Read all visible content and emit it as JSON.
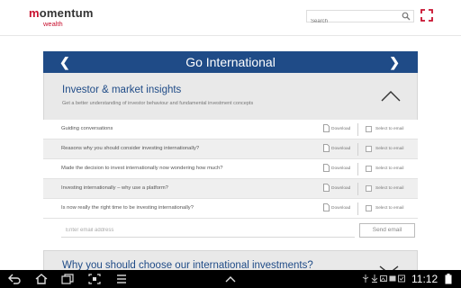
{
  "header": {
    "logo_name": "omentum",
    "logo_initial": "m",
    "logo_sub": "wealth",
    "search_placeholder": "Search"
  },
  "banner": {
    "title": "Go International",
    "prev_glyph": "❮",
    "next_glyph": "❯",
    "color": "#1f4b87"
  },
  "section": {
    "title": "Investor & market insights",
    "description": "Get a better understanding of investor behaviour and fundamental investment concepts",
    "expanded": true
  },
  "rows": [
    {
      "label": "Guiding conversations",
      "download": "Download",
      "select": "Select to email"
    },
    {
      "label": "Reasons why you should consider investing internationally?",
      "download": "Download",
      "select": "Select to email"
    },
    {
      "label": "Made the decision to invest internationally now wondering how much?",
      "download": "Download",
      "select": "Select to email"
    },
    {
      "label": "Investing internationally – why use a platform?",
      "download": "Download",
      "select": "Select to email"
    },
    {
      "label": "Is now really the right time to be investing internationally?",
      "download": "Download",
      "select": "Select to email"
    }
  ],
  "email": {
    "placeholder": "Enter email address",
    "send_label": "Send email"
  },
  "section2": {
    "title": "Why you should choose our international investments?"
  },
  "statusbar": {
    "time": "11:12"
  },
  "colors": {
    "brand_red": "#c8102e",
    "brand_blue": "#1f4b87"
  }
}
